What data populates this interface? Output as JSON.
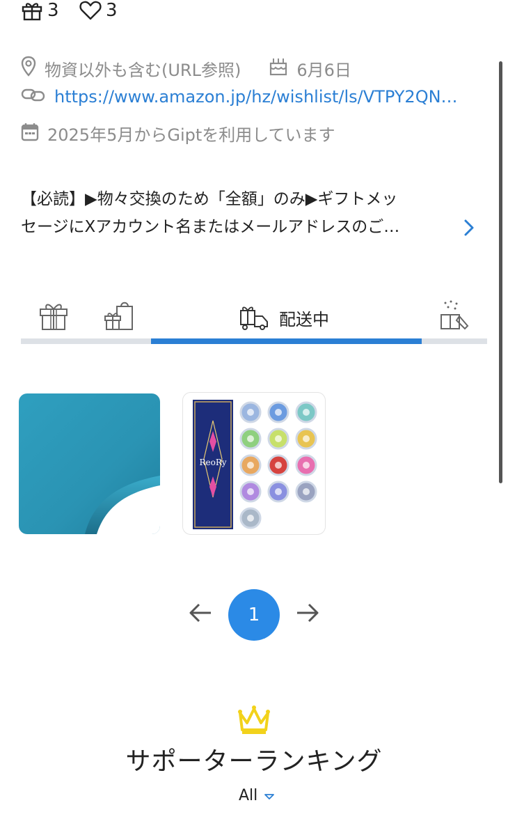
{
  "stats": {
    "gift_count": "3",
    "like_count": "3"
  },
  "profile": {
    "location_text": "物資以外も含む(URL参照)",
    "birthday_text": "6月6日",
    "wishlist_url": "https://www.amazon.jp/hz/wishlist/ls/VTPY2QN…",
    "joined_text": "2025年5月からGiptを利用しています"
  },
  "description": {
    "line1": "【必読】▶物々交換のため「全額」のみ▶ギフトメッ",
    "line2": "セージにXアカウント名またはメールアドレスのご…"
  },
  "tabs": {
    "active_label": "配送中"
  },
  "items": [
    {
      "name": "teal-fabric-item"
    },
    {
      "name": "color-contact-lens-item",
      "brand_text": "ReoRy"
    }
  ],
  "pagination": {
    "current_page": "1"
  },
  "ranking": {
    "title": "サポーターランキング",
    "filter_value": "All"
  },
  "colors": {
    "accent_blue": "#2b7fd4",
    "page_button": "#2b8ae6",
    "crown": "#f2d21b",
    "muted_text": "#8c8c8c",
    "tab_track": "#dde1e6"
  },
  "icons": {
    "gift": "gift-icon",
    "heart": "heart-icon",
    "location": "location-pin-icon",
    "birthday": "birthday-cake-icon",
    "link": "link-icon",
    "calendar": "calendar-icon",
    "chevron": "chevron-right-icon",
    "crown": "crown-icon"
  }
}
